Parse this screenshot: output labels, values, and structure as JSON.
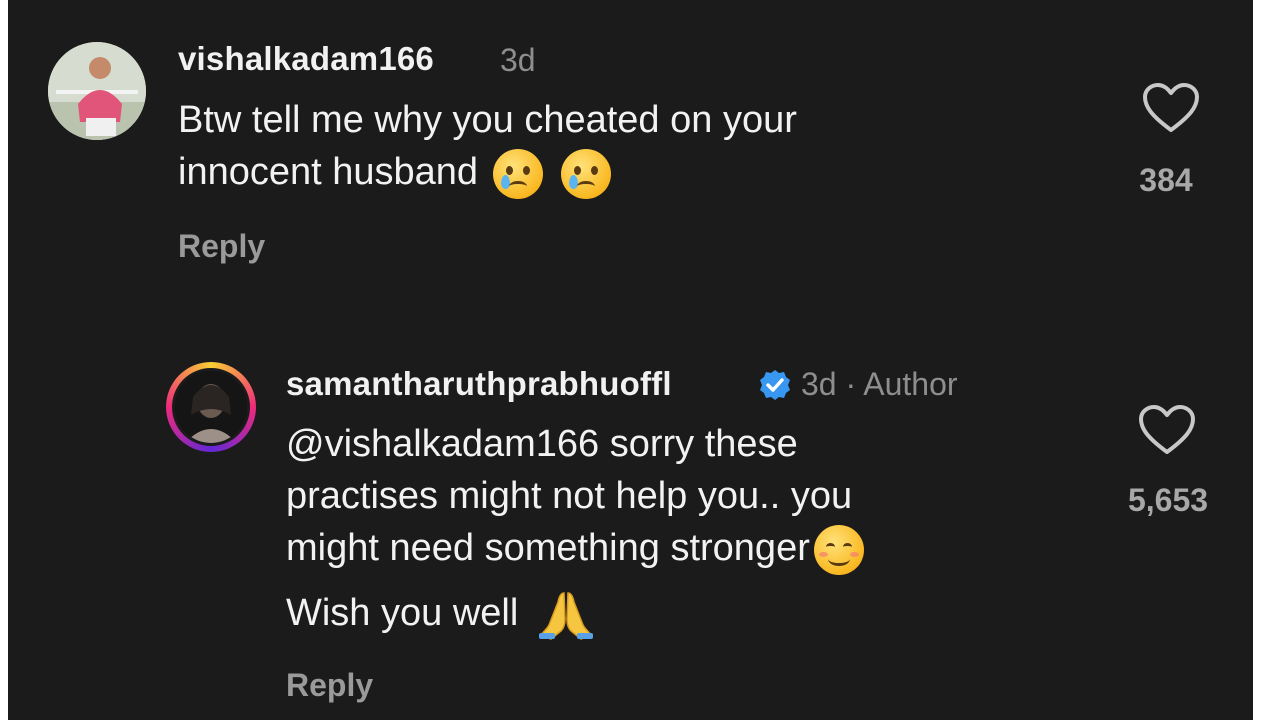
{
  "comments": [
    {
      "username": "vishalkadam166",
      "meta": "3d",
      "text_line1": "Btw tell me why you cheated on your",
      "text_line2": "innocent husband",
      "emoji": [
        "crying-face",
        "crying-face"
      ],
      "reply_label": "Reply",
      "likes": "384"
    },
    {
      "username": "samantharuthprabhuoffl",
      "verified": true,
      "meta": "3d · Author",
      "text_line1": "@vishalkadam166 sorry these",
      "text_line2": "practises might not help you.. you",
      "text_line3": "might need something stronger",
      "text_line4": "Wish you well",
      "emoji": [
        "smiling-face",
        "folded-hands"
      ],
      "reply_label": "Reply",
      "likes": "5,653"
    }
  ],
  "colors": {
    "background": "#1b1b1b",
    "username": "#f1f1f1",
    "meta": "#8e8e8e",
    "verified": "#3897f0"
  }
}
